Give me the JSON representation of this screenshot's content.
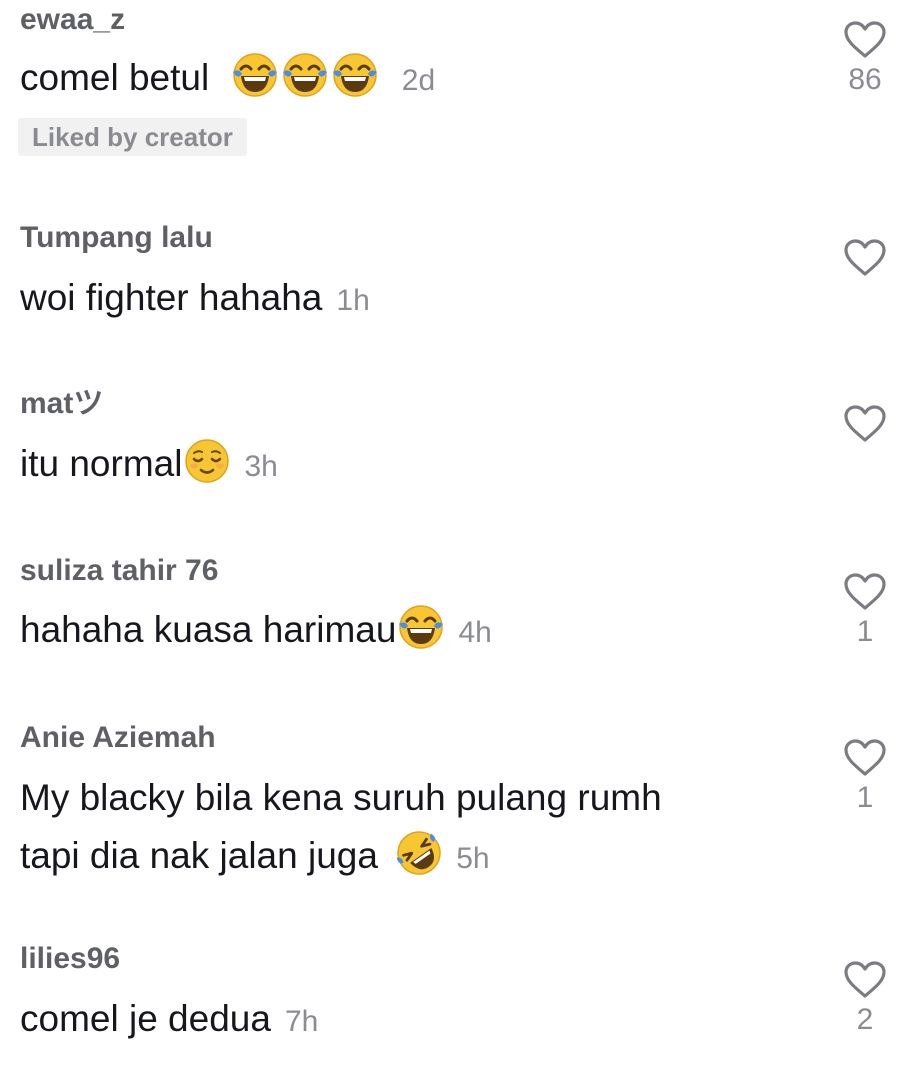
{
  "comments": [
    {
      "username": "ewaa_z",
      "text": "comel betul",
      "emoji": [
        "tears-of-joy-emoji",
        "tears-of-joy-emoji",
        "tears-of-joy-emoji"
      ],
      "time": "2d",
      "tag": "Liked by creator",
      "likes": "86"
    },
    {
      "username": "Tumpang lalu",
      "text": "woi fighter hahaha",
      "time": "1h",
      "likes": ""
    },
    {
      "username": "matツ",
      "text": "itu normal",
      "emoji": [
        "relieved-face-emoji"
      ],
      "time": "3h",
      "likes": ""
    },
    {
      "username": "suliza tahir 76",
      "text": "hahaha kuasa harimau",
      "emoji": [
        "tears-of-joy-emoji"
      ],
      "time": "4h",
      "likes": "1"
    },
    {
      "username": "Anie Aziemah",
      "text_line1": "My blacky bila kena suruh pulang rumh",
      "text_line2": "tapi dia nak jalan juga",
      "emoji": [
        "rolling-on-floor-laughing-emoji"
      ],
      "time": "5h",
      "likes": "1"
    },
    {
      "username": "lilies96",
      "text": "comel je dedua",
      "time": "7h",
      "likes": "2"
    }
  ],
  "colors": {
    "username": "#5f6066",
    "text": "#16171c",
    "muted": "#8b8c91",
    "tag_bg": "#f1f1f2",
    "heart_stroke": "#7b7c82"
  },
  "icons": {
    "like": "heart-outline-icon"
  }
}
